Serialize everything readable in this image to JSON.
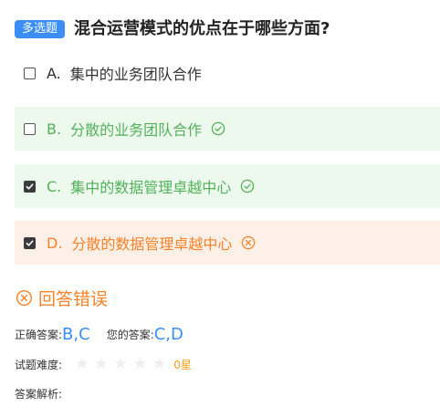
{
  "question": {
    "type_badge": "多选题",
    "title": "混合运营模式的优点在于哪些方面?"
  },
  "options": [
    {
      "letter": "A.",
      "text": "集中的业务团队合作",
      "checked": false,
      "status": "plain"
    },
    {
      "letter": "B.",
      "text": "分散的业务团队合作",
      "checked": false,
      "status": "correct",
      "icon": "check-circle-icon"
    },
    {
      "letter": "C.",
      "text": "集中的数据管理卓越中心",
      "checked": true,
      "status": "correct",
      "icon": "check-circle-icon"
    },
    {
      "letter": "D.",
      "text": "分散的数据管理卓越中心",
      "checked": true,
      "status": "wrong",
      "icon": "x-circle-icon"
    }
  ],
  "result": {
    "text": "回答错误",
    "icon": "x-circle-icon"
  },
  "answers": {
    "correct_label": "正确答案:",
    "correct_value": "B,C",
    "yours_label": "您的答案:",
    "yours_value": "C,D"
  },
  "difficulty": {
    "label": "试题难度:",
    "stars_total": 5,
    "stars_filled": 0,
    "text": "0星"
  },
  "analysis": {
    "label": "答案解析:"
  },
  "colors": {
    "accent_blue": "#3a8ef6",
    "correct_green": "#52b05a",
    "correct_bg": "#eef9ee",
    "wrong_orange": "#f5832a",
    "wrong_bg": "#fef0e6",
    "star_empty": "#eeeeee",
    "difficulty_gold": "#f0a020"
  }
}
